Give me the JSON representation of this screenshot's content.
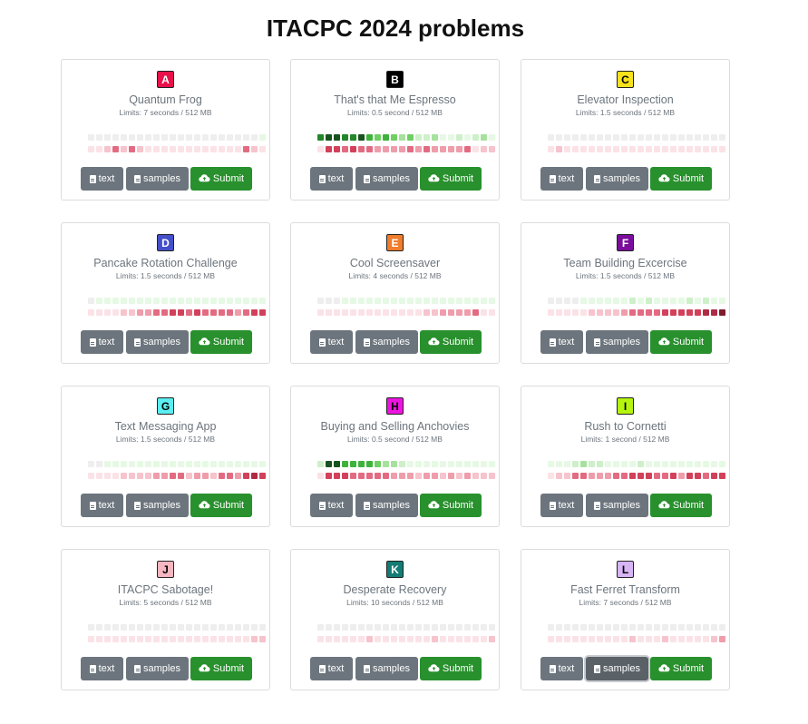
{
  "title": "ITACPC 2024 problems",
  "buttons": {
    "text": "text",
    "samples": "samples",
    "submit": "Submit"
  },
  "problems": [
    {
      "letter": "A",
      "name": "Quantum Frog",
      "limits": "Limits: 7 seconds / 512 MB",
      "color": "#e8114a",
      "letter_color": "#ffffff"
    },
    {
      "letter": "B",
      "name": "That's that Me Espresso",
      "limits": "Limits: 0.5 second / 512 MB",
      "color": "#000000",
      "letter_color": "#ffffff"
    },
    {
      "letter": "C",
      "name": "Elevator Inspection",
      "limits": "Limits: 1.5 seconds / 512 MB",
      "color": "#f7e21c",
      "letter_color": "#000000"
    },
    {
      "letter": "D",
      "name": "Pancake Rotation Challenge",
      "limits": "Limits: 1.5 seconds / 512 MB",
      "color": "#4450c9",
      "letter_color": "#ffffff"
    },
    {
      "letter": "E",
      "name": "Cool Screensaver",
      "limits": "Limits: 4 seconds / 512 MB",
      "color": "#ef7d2b",
      "letter_color": "#ffffff"
    },
    {
      "letter": "F",
      "name": "Team Building Excercise",
      "limits": "Limits: 1.5 seconds / 512 MB",
      "color": "#7b0d9d",
      "letter_color": "#ffffff"
    },
    {
      "letter": "G",
      "name": "Text Messaging App",
      "limits": "Limits: 1.5 seconds / 512 MB",
      "color": "#5ceef0",
      "letter_color": "#000000"
    },
    {
      "letter": "H",
      "name": "Buying and Selling Anchovies",
      "limits": "Limits: 0.5 second / 512 MB",
      "color": "#ee14e0",
      "letter_color": "#000000"
    },
    {
      "letter": "I",
      "name": "Rush to Cornetti",
      "limits": "Limits: 1 second / 512 MB",
      "color": "#b4f40f",
      "letter_color": "#000000"
    },
    {
      "letter": "J",
      "name": "ITACPC Sabotage!",
      "limits": "Limits: 5 seconds / 512 MB",
      "color": "#f5b6bf",
      "letter_color": "#000000"
    },
    {
      "letter": "K",
      "name": "Desperate Recovery",
      "limits": "Limits: 10 seconds / 512 MB",
      "color": "#147c74",
      "letter_color": "#ffffff"
    },
    {
      "letter": "L",
      "name": "Fast Ferret Transform",
      "limits": "Limits: 7 seconds / 512 MB",
      "color": "#d7b4f4",
      "letter_color": "#000000"
    }
  ]
}
